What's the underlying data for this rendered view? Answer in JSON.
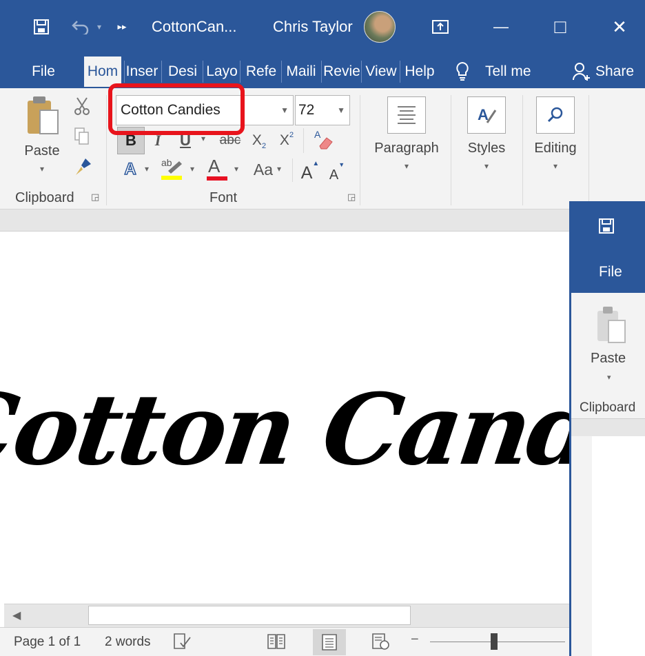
{
  "titlebar": {
    "doc_title": "CottonCan...",
    "user_name": "Chris Taylor",
    "restore_glyph": "□",
    "close_glyph": "✕",
    "minimize_glyph": "—",
    "overflow_glyph": "▸▸"
  },
  "tabs": [
    {
      "label": "File"
    },
    {
      "label": "Hom"
    },
    {
      "label": "Inser"
    },
    {
      "label": "Desi"
    },
    {
      "label": "Layo"
    },
    {
      "label": "Refe"
    },
    {
      "label": "Maili"
    },
    {
      "label": "Revie"
    },
    {
      "label": "View"
    },
    {
      "label": "Help"
    }
  ],
  "tell_me": "Tell me",
  "share": "Share",
  "ribbon": {
    "clipboard": {
      "paste": "Paste",
      "group_label": "Clipboard"
    },
    "font": {
      "font_name": "Cotton Candies",
      "font_size": "72",
      "bold": "B",
      "italic": "I",
      "underline": "U",
      "strike": "abc",
      "subscript": "X",
      "subscript_mark": "2",
      "superscript": "X",
      "superscript_mark": "2",
      "change_case": "Aa",
      "grow": "A",
      "shrink": "A",
      "font_color": "A",
      "text_effects": "A",
      "highlight": "ab",
      "group_label": "Font"
    },
    "paragraph": {
      "label": "Paragraph"
    },
    "styles": {
      "label": "Styles"
    },
    "editing": {
      "label": "Editing"
    }
  },
  "document": {
    "text": "Cotton Candy"
  },
  "statusbar": {
    "page": "Page 1 of 1",
    "words": "2 words"
  },
  "second_window": {
    "file": "File",
    "paste": "Paste",
    "clipboard": "Clipboard"
  },
  "colors": {
    "accent": "#2b579a",
    "highlight_callout": "#e8141c",
    "highlight_yellow": "#ffff00",
    "font_red": "#e81123"
  }
}
